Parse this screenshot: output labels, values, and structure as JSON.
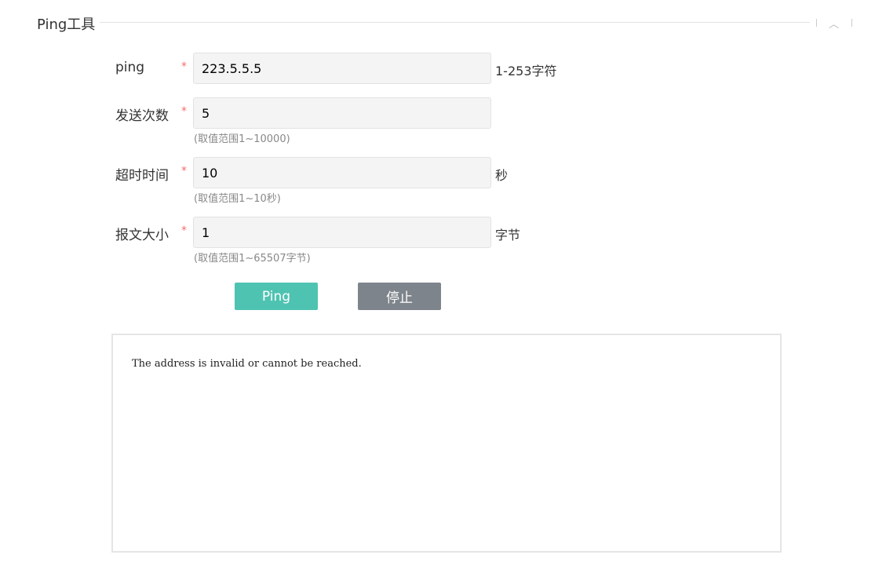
{
  "section": {
    "title": "Ping工具",
    "collapse_icon": "chevron-up-icon",
    "collapse_glyph": "︿"
  },
  "form": {
    "ping": {
      "label": "ping",
      "required_mark": "*",
      "value": "223.5.5.5",
      "suffix": "1-253字符"
    },
    "send_count": {
      "label": "发送次数",
      "required_mark": "*",
      "value": "5",
      "hint": "(取值范围1~10000)"
    },
    "timeout": {
      "label": "超时时间",
      "required_mark": "*",
      "value": "10",
      "suffix": "秒",
      "hint": "(取值范围1~10秒)"
    },
    "packet_size": {
      "label": "报文大小",
      "required_mark": "*",
      "value": "1",
      "suffix": "字节",
      "hint": "(取值范围1~65507字节)"
    }
  },
  "buttons": {
    "ping_label": "Ping",
    "stop_label": "停止"
  },
  "output": {
    "text": "The address is invalid or cannot be reached."
  },
  "colors": {
    "ping_button": "#4fc3b2",
    "stop_button": "#7e848b",
    "required_mark": "#f56c6c",
    "input_background": "#f4f4f4"
  }
}
